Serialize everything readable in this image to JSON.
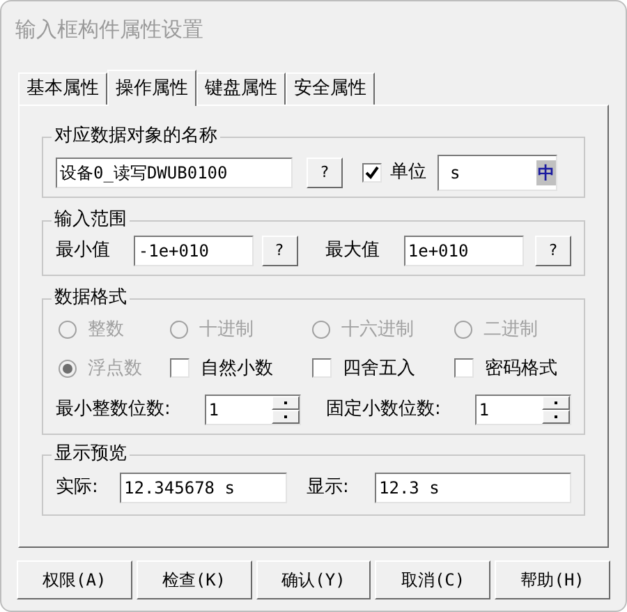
{
  "window": {
    "title": "输入框构件属性设置"
  },
  "tabs": [
    {
      "label": "基本属性",
      "selected": false
    },
    {
      "label": "操作属性",
      "selected": true
    },
    {
      "label": "键盘属性",
      "selected": false
    },
    {
      "label": "安全属性",
      "selected": false
    }
  ],
  "object_name": {
    "title": "对应数据对象的名称",
    "value": "设备0_读写DWUB0100",
    "help": "?",
    "unit_checked": true,
    "unit_label": "单位",
    "unit_value": "s",
    "ime_glyph": "中"
  },
  "range": {
    "title": "输入范围",
    "min_label": "最小值",
    "min_value": "-1e+010",
    "min_help": "?",
    "max_label": "最大值",
    "max_value": "1e+010",
    "max_help": "?"
  },
  "format": {
    "title": "数据格式",
    "options": [
      {
        "kind": "radio",
        "label": "整数",
        "selected": false,
        "disabled": true
      },
      {
        "kind": "radio",
        "label": "十进制",
        "selected": false,
        "disabled": true
      },
      {
        "kind": "radio",
        "label": "十六进制",
        "selected": false,
        "disabled": true
      },
      {
        "kind": "radio",
        "label": "二进制",
        "selected": false,
        "disabled": true
      },
      {
        "kind": "radio",
        "label": "浮点数",
        "selected": true,
        "disabled": true
      },
      {
        "kind": "checkbox",
        "label": "自然小数",
        "checked": false
      },
      {
        "kind": "checkbox",
        "label": "四舍五入",
        "checked": false
      },
      {
        "kind": "checkbox",
        "label": "密码格式",
        "checked": false
      }
    ],
    "min_int_label": "最小整数位数:",
    "min_int_value": "1",
    "fixed_dec_label": "固定小数位数:",
    "fixed_dec_value": "1"
  },
  "preview": {
    "title": "显示预览",
    "actual_label": "实际:",
    "actual_value": "12.345678 s",
    "shown_label": "显示:",
    "shown_value": "12.3 s"
  },
  "buttons": [
    "权限(A)",
    "检查(K)",
    "确认(Y)",
    "取消(C)",
    "帮助(H)"
  ]
}
